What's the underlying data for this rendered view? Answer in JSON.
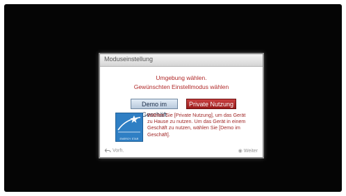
{
  "dialog": {
    "title": "Moduseinstellung",
    "prompt_line1": "Umgebung wählen.",
    "prompt_line2": "Gewünschten Einstellmodus wählen",
    "options": {
      "demo_label": "Demo im Geschäft",
      "private_label": "Private Nutzung"
    },
    "selected_option": "Private Nutzung",
    "info_line1": "Wählen Sie [Private Nutzung], um das Gerät",
    "info_line2": "zu Hause zu nutzen. Um das Gerät in einem",
    "info_line3": "Geschäft zu nutzen, wählen Sie [Demo im",
    "info_line4": "Geschäft].",
    "logo_text": "ENERGY STAR",
    "footer": {
      "back_label": "Vorh.",
      "next_label": "Weiter"
    }
  },
  "colors": {
    "accent_red": "#a02626",
    "selected_button": "#9a1c1c",
    "unselected_button": "#b8c9dc"
  },
  "icons": {
    "back": "back-arrow-icon",
    "next": "ok-dot-icon",
    "logo": "energy-star-icon"
  }
}
